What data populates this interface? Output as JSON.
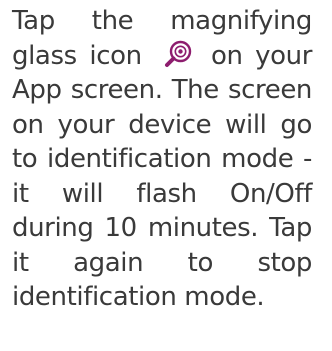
{
  "instruction": {
    "part1": "Tap the magnifying glass icon",
    "icon": "magnifying-glass-icon",
    "icon_color": "#8d1d6e",
    "part2": "on your App screen. The screen on your device will go to identification mode - it will flash On/Off during 10 minutes. Tap it again to stop identification mode."
  }
}
